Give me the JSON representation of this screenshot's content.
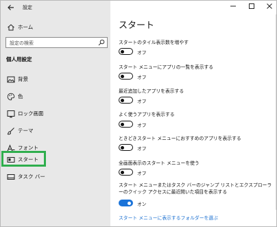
{
  "window": {
    "title": "設定"
  },
  "sidebar": {
    "home": "ホーム",
    "search_placeholder": "設定の検索",
    "section": "個人用設定",
    "items": [
      {
        "label": "背景",
        "icon": "image-icon"
      },
      {
        "label": "色",
        "icon": "palette-icon"
      },
      {
        "label": "ロック画面",
        "icon": "lock-screen-icon"
      },
      {
        "label": "テーマ",
        "icon": "brush-icon"
      },
      {
        "label": "フォント",
        "icon": "font-icon"
      },
      {
        "label": "スタート",
        "icon": "start-icon",
        "selected": true
      },
      {
        "label": "タスク バー",
        "icon": "taskbar-icon"
      }
    ]
  },
  "main": {
    "title": "スタート",
    "settings": [
      {
        "label": "スタートのタイル表示数を増やす",
        "state": "オフ",
        "on": false
      },
      {
        "label": "スタート メニューにアプリの一覧を表示する",
        "state": "オフ",
        "on": false
      },
      {
        "label": "最近追加したアプリを表示する",
        "state": "オフ",
        "on": false
      },
      {
        "label": "よく使うアプリを表示する",
        "state": "オフ",
        "on": false
      },
      {
        "label": "ときどきスタート メニューにおすすめのアプリを表示する",
        "state": "オフ",
        "on": false
      },
      {
        "label": "全画面表示のスタート メニューを使う",
        "state": "オフ",
        "on": false
      },
      {
        "label": "スタート メニューまたはタスク バーのジャンプ リストとエクスプローラーのクイック アクセスに最近開いた項目を表示する",
        "state": "オン",
        "on": true
      }
    ],
    "link": "スタート メニューに表示するフォルダーを選ぶ"
  },
  "colors": {
    "accent": "#1a73d9",
    "highlight": "#2fae4d",
    "sidebar_bg": "#e8e8e8"
  }
}
